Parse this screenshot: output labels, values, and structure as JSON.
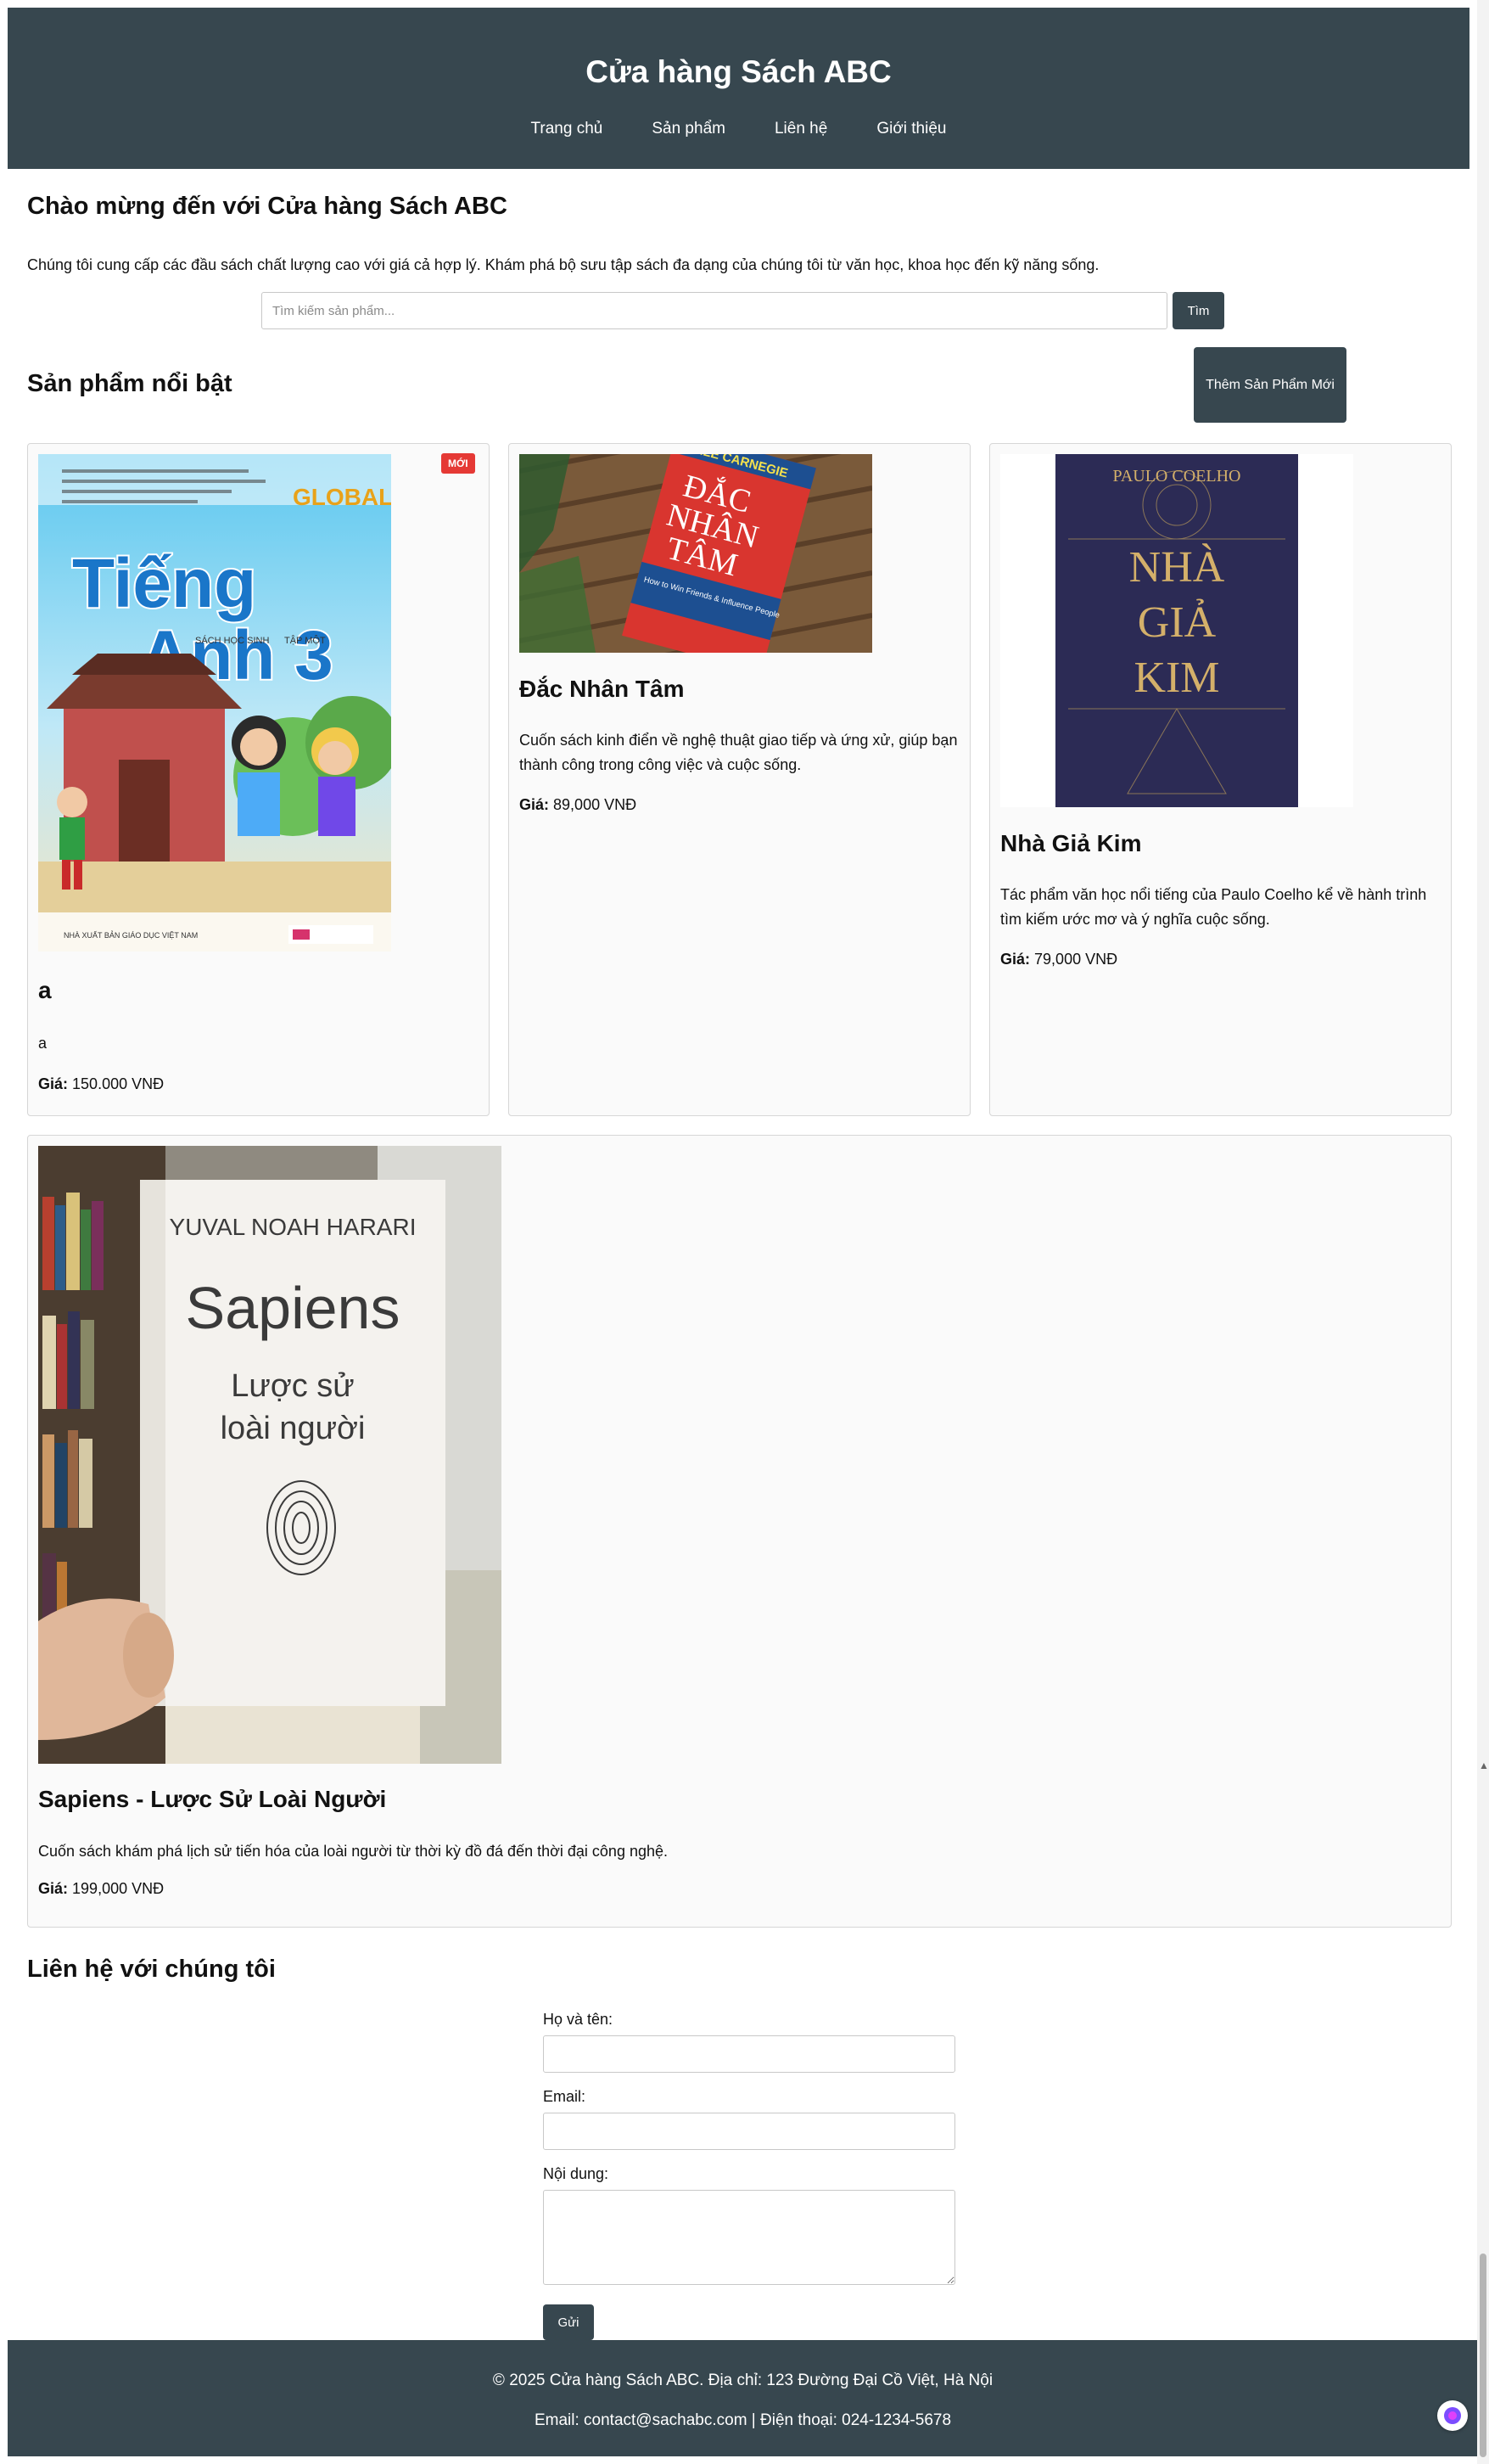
{
  "header": {
    "title": "Cửa hàng Sách ABC",
    "nav": [
      "Trang chủ",
      "Sản phẩm",
      "Liên hệ",
      "Giới thiệu"
    ]
  },
  "welcome": {
    "title": "Chào mừng đến với Cửa hàng Sách ABC",
    "text": "Chúng tôi cung cấp các đầu sách chất lượng cao với giá cả hợp lý. Khám phá bộ sưu tập sách đa dạng của chúng tôi từ văn học, khoa học đến kỹ năng sống."
  },
  "search": {
    "placeholder": "Tìm kiếm sản phẩm...",
    "button": "Tìm"
  },
  "featured": {
    "title": "Sản phẩm nổi bật",
    "add_button": "Thêm Sản Phẩm Mới"
  },
  "products": [
    {
      "badge": "MỚI",
      "name": "a",
      "desc": "a",
      "price_label": "Giá:",
      "price": "150.000 VNĐ",
      "cover": {
        "title_line1": "Tiếng",
        "title_line2": "Anh 3",
        "brand": "GLOBAL SUCCESS",
        "subtitle": "SÁCH HỌC SINH",
        "tap": "TẬP MỘT",
        "publisher": "NHÀ XUẤT BẢN GIÁO DỤC VIỆT NAM"
      }
    },
    {
      "name": "Đắc Nhân Tâm",
      "desc": "Cuốn sách kinh điển về nghệ thuật giao tiếp và ứng xử, giúp bạn thành công trong công việc và cuộc sống.",
      "price_label": "Giá:",
      "price": "89,000 VNĐ",
      "cover": {
        "author": "DALE CARNEGIE",
        "title_line1": "ĐẮC",
        "title_line2": "NHÂN",
        "title_line3": "TÂM",
        "subtitle": "How to Win Friends & Influence People"
      }
    },
    {
      "name": "Nhà Giả Kim",
      "desc": "Tác phẩm văn học nổi tiếng của Paulo Coelho kể về hành trình tìm kiếm ước mơ và ý nghĩa cuộc sống.",
      "price_label": "Giá:",
      "price": "79,000 VNĐ",
      "cover": {
        "author": "PAULO COELHO",
        "title_line1": "NHÀ",
        "title_line2": "GIẢ",
        "title_line3": "KIM"
      }
    },
    {
      "name": "Sapiens - Lược Sử Loài Người",
      "desc": "Cuốn sách khám phá lịch sử tiến hóa của loài người từ thời kỳ đồ đá đến thời đại công nghệ.",
      "price_label": "Giá:",
      "price": "199,000 VNĐ",
      "cover": {
        "author": "YUVAL NOAH HARARI",
        "title": "Sapiens",
        "subtitle_line1": "Lược sử",
        "subtitle_line2": "loài người"
      }
    }
  ],
  "contact": {
    "title": "Liên hệ với chúng tôi",
    "name_label": "Họ và tên:",
    "email_label": "Email:",
    "message_label": "Nội dung:",
    "send_button": "Gửi"
  },
  "footer": {
    "line1": "© 2025 Cửa hàng Sách ABC. Địa chỉ: 123 Đường Đại Cồ Việt, Hà Nội",
    "line2": "Email: contact@sachabc.com | Điện thoại: 024-1234-5678"
  },
  "colors": {
    "header_bg": "#37474f",
    "badge": "#e53935",
    "card_bg": "#fafafa"
  }
}
